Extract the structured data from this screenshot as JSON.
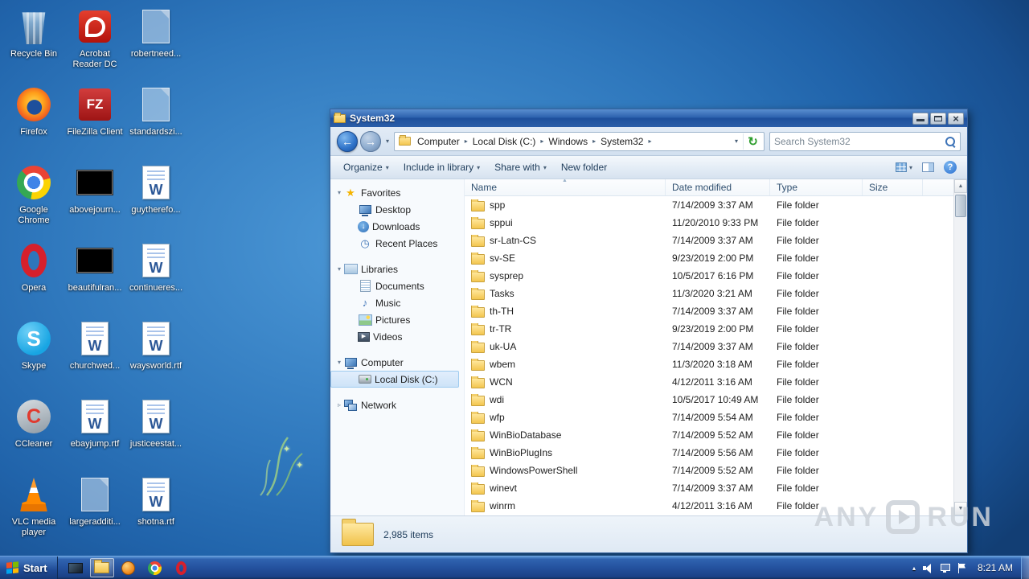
{
  "icons": {
    "caret_down": "▾",
    "crumb_separator": "▸",
    "back_arrow": "←",
    "forward_arrow": "→",
    "refresh": "↻",
    "sort_ascending": "▲",
    "scroll_up": "▲",
    "scroll_down": "▼",
    "help": "?",
    "tray_chevron": "▴"
  },
  "desktop": {
    "icons": [
      {
        "label": "Recycle Bin",
        "type": "t-bin",
        "glyph": ""
      },
      {
        "label": "Firefox",
        "type": "t-firefox",
        "glyph": ""
      },
      {
        "label": "Google Chrome",
        "type": "t-chrome",
        "glyph": ""
      },
      {
        "label": "Opera",
        "type": "t-opera",
        "glyph": ""
      },
      {
        "label": "Skype",
        "type": "t-skype",
        "glyph": "S"
      },
      {
        "label": "CCleaner",
        "type": "t-ccleaner",
        "glyph": "C"
      },
      {
        "label": "VLC media player",
        "type": "t-vlc",
        "glyph": ""
      },
      {
        "label": "Acrobat Reader DC",
        "type": "t-acrobat",
        "glyph": ""
      },
      {
        "label": "FileZilla Client",
        "type": "t-filezilla",
        "glyph": "FZ"
      },
      {
        "label": "abovejourn...",
        "type": "t-black",
        "glyph": ""
      },
      {
        "label": "beautifulran...",
        "type": "t-black",
        "glyph": ""
      },
      {
        "label": "churchwed...",
        "type": "t-word",
        "glyph": "W"
      },
      {
        "label": "ebayjump.rtf",
        "type": "t-word",
        "glyph": "W"
      },
      {
        "label": "largeradditi...",
        "type": "t-ghost",
        "glyph": ""
      },
      {
        "label": "robertneed...",
        "type": "t-ghost",
        "glyph": ""
      },
      {
        "label": "standardszi...",
        "type": "t-ghost",
        "glyph": ""
      },
      {
        "label": "guytherefo...",
        "type": "t-word",
        "glyph": "W"
      },
      {
        "label": "continueres...",
        "type": "t-word",
        "glyph": "W"
      },
      {
        "label": "waysworld.rtf",
        "type": "t-word",
        "glyph": "W"
      },
      {
        "label": "justiceestat...",
        "type": "t-word",
        "glyph": "W"
      },
      {
        "label": "shotna.rtf",
        "type": "t-word",
        "glyph": "W"
      }
    ]
  },
  "window": {
    "title": "System32",
    "address": {
      "crumbs": [
        "Computer",
        "Local Disk (C:)",
        "Windows",
        "System32"
      ]
    },
    "search": {
      "placeholder": "Search System32"
    },
    "toolbar": {
      "buttons": [
        {
          "label": "Organize",
          "caret": "▾"
        },
        {
          "label": "Include in library",
          "caret": "▾"
        },
        {
          "label": "Share with",
          "caret": "▾"
        },
        {
          "label": "New folder",
          "caret": ""
        }
      ]
    },
    "nav": [
      {
        "label": "Favorites",
        "cls": "root",
        "exp": "▾",
        "icon": "i-star",
        "ig": "★"
      },
      {
        "label": "Desktop",
        "cls": "child",
        "exp": "",
        "icon": "i-desktop",
        "ig": ""
      },
      {
        "label": "Downloads",
        "cls": "child",
        "exp": "",
        "icon": "i-downloads",
        "ig": "↓"
      },
      {
        "label": "Recent Places",
        "cls": "child",
        "exp": "",
        "icon": "i-recent",
        "ig": "◷"
      },
      {
        "label": "Libraries",
        "cls": "root gap",
        "exp": "▾",
        "icon": "i-lib",
        "ig": ""
      },
      {
        "label": "Documents",
        "cls": "child",
        "exp": "",
        "icon": "i-doc",
        "ig": ""
      },
      {
        "label": "Music",
        "cls": "child",
        "exp": "",
        "icon": "i-music",
        "ig": "♪"
      },
      {
        "label": "Pictures",
        "cls": "child",
        "exp": "",
        "icon": "i-pics",
        "ig": ""
      },
      {
        "label": "Videos",
        "cls": "child",
        "exp": "",
        "icon": "i-videos",
        "ig": "▶"
      },
      {
        "label": "Computer",
        "cls": "root gap",
        "exp": "▾",
        "icon": "i-computer",
        "ig": ""
      },
      {
        "label": "Local Disk (C:)",
        "cls": "child selected",
        "exp": "",
        "icon": "i-disk",
        "ig": ""
      },
      {
        "label": "Network",
        "cls": "root gap",
        "exp": "▹",
        "icon": "i-network",
        "ig": ""
      }
    ],
    "columns": [
      "Name",
      "Date modified",
      "Type",
      "Size"
    ],
    "files": [
      {
        "name": "spp",
        "date": "7/14/2009 3:37 AM",
        "type": "File folder"
      },
      {
        "name": "sppui",
        "date": "11/20/2010 9:33 PM",
        "type": "File folder"
      },
      {
        "name": "sr-Latn-CS",
        "date": "7/14/2009 3:37 AM",
        "type": "File folder"
      },
      {
        "name": "sv-SE",
        "date": "9/23/2019 2:00 PM",
        "type": "File folder"
      },
      {
        "name": "sysprep",
        "date": "10/5/2017 6:16 PM",
        "type": "File folder"
      },
      {
        "name": "Tasks",
        "date": "11/3/2020 3:21 AM",
        "type": "File folder"
      },
      {
        "name": "th-TH",
        "date": "7/14/2009 3:37 AM",
        "type": "File folder"
      },
      {
        "name": "tr-TR",
        "date": "9/23/2019 2:00 PM",
        "type": "File folder"
      },
      {
        "name": "uk-UA",
        "date": "7/14/2009 3:37 AM",
        "type": "File folder"
      },
      {
        "name": "wbem",
        "date": "11/3/2020 3:18 AM",
        "type": "File folder"
      },
      {
        "name": "WCN",
        "date": "4/12/2011 3:16 AM",
        "type": "File folder"
      },
      {
        "name": "wdi",
        "date": "10/5/2017 10:49 AM",
        "type": "File folder"
      },
      {
        "name": "wfp",
        "date": "7/14/2009 5:54 AM",
        "type": "File folder"
      },
      {
        "name": "WinBioDatabase",
        "date": "7/14/2009 5:52 AM",
        "type": "File folder"
      },
      {
        "name": "WinBioPlugIns",
        "date": "7/14/2009 5:56 AM",
        "type": "File folder"
      },
      {
        "name": "WindowsPowerShell",
        "date": "7/14/2009 5:52 AM",
        "type": "File folder"
      },
      {
        "name": "winevt",
        "date": "7/14/2009 3:37 AM",
        "type": "File folder"
      },
      {
        "name": "winrm",
        "date": "4/12/2011 3:16 AM",
        "type": "File folder"
      }
    ],
    "status": "2,985 items"
  },
  "taskbar": {
    "start_label": "Start",
    "clock": "8:21 AM",
    "apps": [
      {
        "name": "program",
        "cls": "q-prog",
        "state": ""
      },
      {
        "name": "windows-explorer",
        "cls": "q-explorer",
        "state": "active"
      },
      {
        "name": "media-player",
        "cls": "q-media",
        "state": ""
      },
      {
        "name": "chrome",
        "cls": "q-chrome",
        "state": ""
      },
      {
        "name": "opera",
        "cls": "q-opera",
        "state": ""
      }
    ]
  },
  "watermark": {
    "left": "ANY",
    "right": "RUN"
  }
}
